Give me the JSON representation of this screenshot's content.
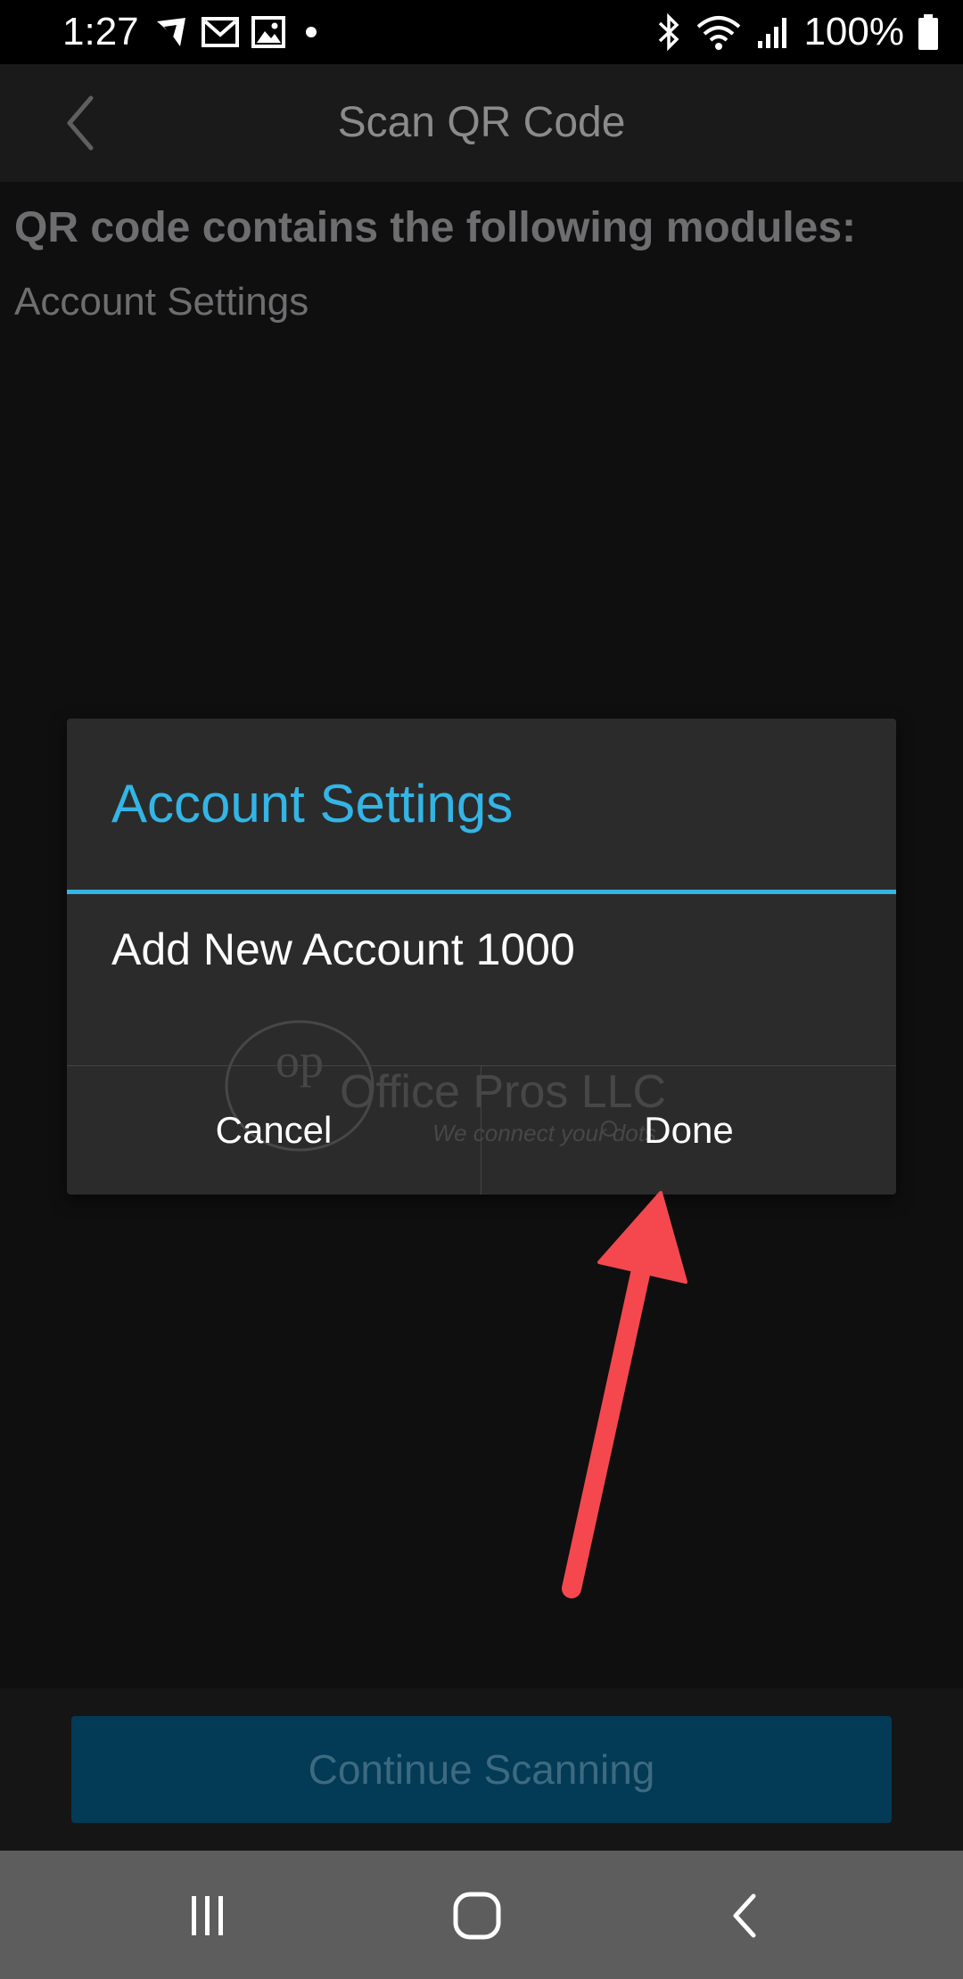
{
  "status_bar": {
    "time": "1:27",
    "battery": "100%",
    "icons_left": [
      "vpn-icon",
      "gmail-icon",
      "gallery-icon",
      "dot-icon"
    ],
    "icons_right": [
      "bluetooth-icon",
      "wifi-icon",
      "signal-icon",
      "battery-icon"
    ]
  },
  "app_bar": {
    "title": "Scan QR Code",
    "back_icon": "chevron-left-icon"
  },
  "content": {
    "heading": "QR code contains the following modules:",
    "modules": [
      "Account Settings"
    ]
  },
  "dialog": {
    "title": "Account Settings",
    "message": "Add New Account 1000",
    "cancel_label": "Cancel",
    "done_label": "Done",
    "watermark": {
      "logo": "op",
      "company": "Office Pros LLC",
      "tagline": "We connect your dots"
    }
  },
  "bottom": {
    "continue_label": "Continue Scanning"
  },
  "nav_bar": {
    "icons": [
      "recent-apps-icon",
      "home-icon",
      "back-icon"
    ]
  },
  "colors": {
    "accent": "#33b5e5",
    "continue_button_bg": "#033a55",
    "annotation_arrow": "#f4484e"
  }
}
